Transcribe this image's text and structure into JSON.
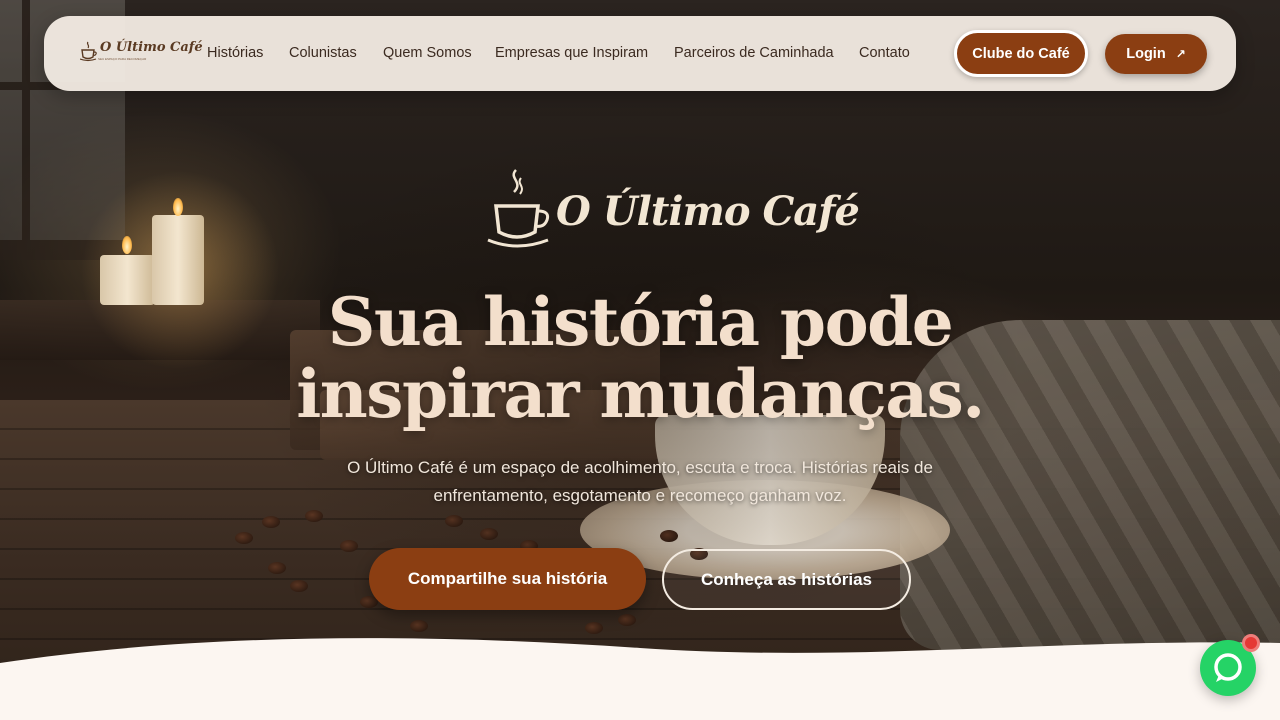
{
  "brand": {
    "name": "O Último Café",
    "logo_tagline": "SEU ESPAÇO PARA RECOMEÇAR"
  },
  "nav": {
    "links": [
      {
        "label": "Histórias"
      },
      {
        "label": "Colunistas"
      },
      {
        "label": "Quem Somos"
      },
      {
        "label": "Empresas que Inspiram"
      },
      {
        "label": "Parceiros de Caminhada"
      },
      {
        "label": "Contato"
      }
    ],
    "club_button": "Clube do Café",
    "login_button": "Login",
    "login_icon": "arrow-up-right-icon"
  },
  "hero": {
    "logo_text": "O Último Café",
    "headline_line1": "Sua história pode",
    "headline_line2": "inspirar mudanças.",
    "subtitle": "O Último Café é um espaço de acolhimento, escuta e troca. Histórias reais de enfrentamento, esgotamento e recomeço ganham voz.",
    "primary_button": "Compartilhe sua história",
    "secondary_button": "Conheça as histórias"
  },
  "chat": {
    "icon": "chat-bubble-icon",
    "notification_color": "#e53935"
  },
  "colors": {
    "accent": "#8b3e12",
    "nav_bg": "#f3ece4",
    "headline": "#f3dfcc",
    "chat": "#25d366",
    "wave": "#fcf6f1"
  }
}
